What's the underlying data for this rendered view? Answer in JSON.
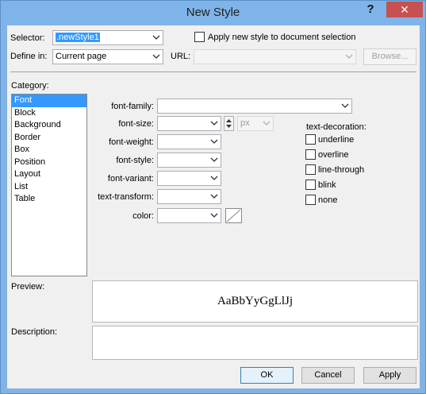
{
  "window": {
    "title": "New Style",
    "help_glyph": "?",
    "close_glyph": "✕"
  },
  "selector": {
    "label": "Selector:",
    "value": ".newStyle1"
  },
  "apply_new_style": {
    "label": "Apply new style to document selection",
    "checked": false
  },
  "define_in": {
    "label": "Define in:",
    "value": "Current page"
  },
  "url": {
    "label": "URL:",
    "value": "",
    "browse_label": "Browse..."
  },
  "category": {
    "label": "Category:",
    "items": [
      "Font",
      "Block",
      "Background",
      "Border",
      "Box",
      "Position",
      "Layout",
      "List",
      "Table"
    ],
    "selected": "Font"
  },
  "font": {
    "family_label": "font-family:",
    "size_label": "font-size:",
    "size_unit": "px",
    "weight_label": "font-weight:",
    "style_label": "font-style:",
    "variant_label": "font-variant:",
    "transform_label": "text-transform:",
    "color_label": "color:"
  },
  "text_decoration": {
    "label": "text-decoration:",
    "options": [
      "underline",
      "overline",
      "line-through",
      "blink",
      "none"
    ]
  },
  "preview": {
    "label": "Preview:",
    "sample": "AaBbYyGgLlJj"
  },
  "description": {
    "label": "Description:",
    "value": ""
  },
  "buttons": {
    "ok": "OK",
    "cancel": "Cancel",
    "apply": "Apply"
  },
  "colors": {
    "titlebar": "#7eb4ea",
    "close": "#c75050",
    "selection": "#3399ff",
    "dialog_bg": "#f0f0f0"
  }
}
